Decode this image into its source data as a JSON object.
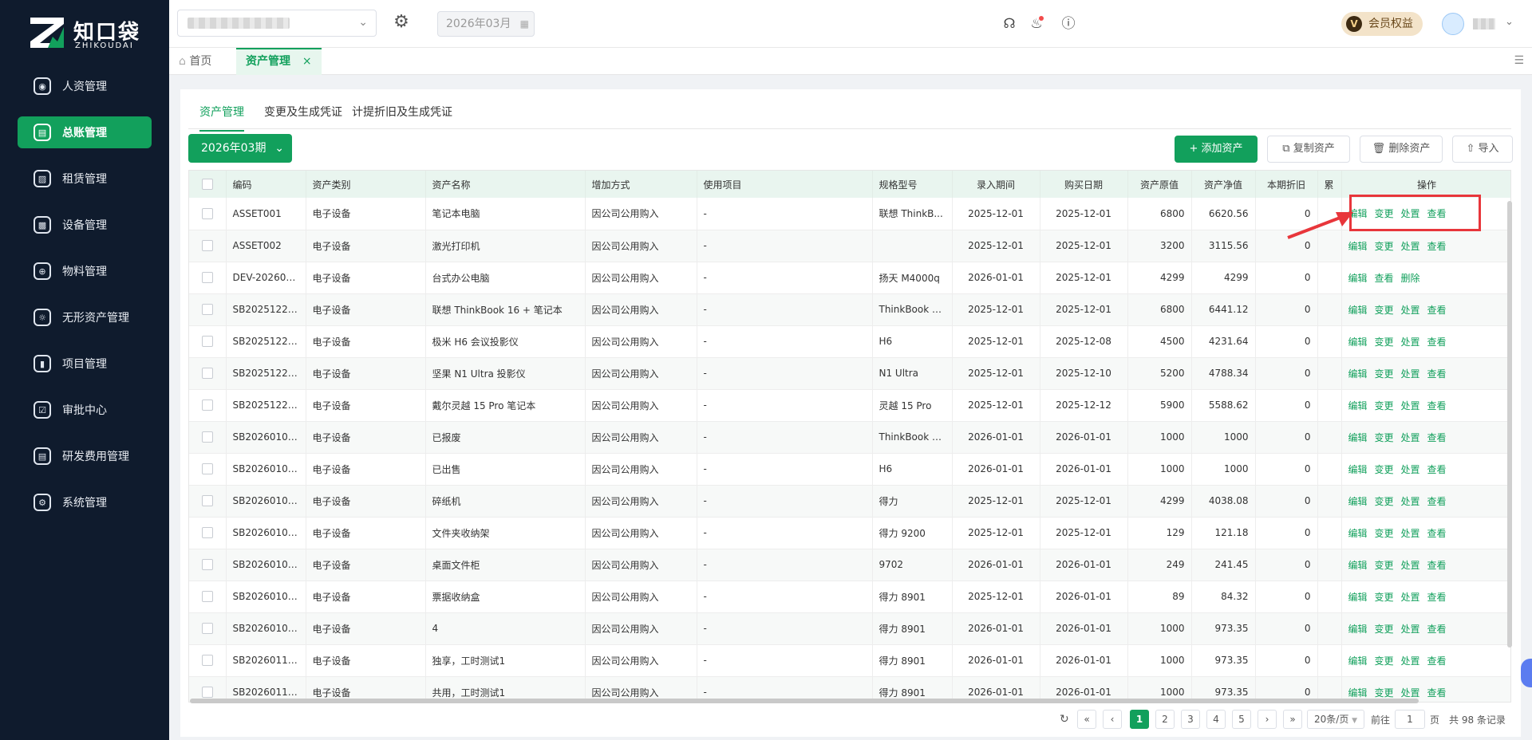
{
  "brand": {
    "name_cn": "知口袋",
    "name_en": "ZHIKOUDAI"
  },
  "sidebar": {
    "items": [
      {
        "label": "人资管理",
        "icon": "person-icon",
        "active": false
      },
      {
        "label": "总账管理",
        "icon": "ledger-icon",
        "active": true
      },
      {
        "label": "租赁管理",
        "icon": "lease-icon",
        "active": false
      },
      {
        "label": "设备管理",
        "icon": "device-icon",
        "active": false
      },
      {
        "label": "物料管理",
        "icon": "material-icon",
        "active": false
      },
      {
        "label": "无形资产管理",
        "icon": "intangible-icon",
        "active": false
      },
      {
        "label": "项目管理",
        "icon": "project-icon",
        "active": false
      },
      {
        "label": "审批中心",
        "icon": "approval-icon",
        "active": false
      },
      {
        "label": "研发费用管理",
        "icon": "rd-icon",
        "active": false
      },
      {
        "label": "系统管理",
        "icon": "gear-icon",
        "active": false
      }
    ]
  },
  "header": {
    "month": "2026年03月",
    "vip_label": "会员权益",
    "vip_badge": "V"
  },
  "tabs": {
    "home": "首页",
    "active": "资产管理"
  },
  "subtabs": [
    "资产管理",
    "变更及生成凭证",
    "计提折旧及生成凭证"
  ],
  "toolbar": {
    "period": "2026年03期",
    "add": "添加资产",
    "copy": "复制资产",
    "delete": "删除资产",
    "import": "导入"
  },
  "table": {
    "columns": [
      "编码",
      "资产类别",
      "资产名称",
      "增加方式",
      "使用项目",
      "规格型号",
      "录入期间",
      "购买日期",
      "资产原值",
      "资产净值",
      "本期折旧",
      "累",
      "操作"
    ],
    "rows": [
      {
        "code": "ASSET001",
        "cat": "电子设备",
        "name": "笔记本电脑",
        "add": "因公司公用购入",
        "proj": "-",
        "model": "联想 ThinkB...",
        "entry": "2025-12-01",
        "buy": "2025-12-01",
        "orig": "6800",
        "net": "6620.56",
        "dep": "0",
        "ops": [
          "编辑",
          "变更",
          "处置",
          "查看"
        ]
      },
      {
        "code": "ASSET002",
        "cat": "电子设备",
        "name": "激光打印机",
        "add": "因公司公用购入",
        "proj": "-",
        "model": "",
        "entry": "2025-12-01",
        "buy": "2025-12-01",
        "orig": "3200",
        "net": "3115.56",
        "dep": "0",
        "ops": [
          "编辑",
          "变更",
          "处置",
          "查看"
        ]
      },
      {
        "code": "DEV-202601...",
        "cat": "电子设备",
        "name": "台式办公电脑",
        "add": "因公司公用购入",
        "proj": "-",
        "model": "扬天 M4000q",
        "entry": "2026-01-01",
        "buy": "2025-12-01",
        "orig": "4299",
        "net": "4299",
        "dep": "0",
        "ops": [
          "编辑",
          "查看",
          "删除"
        ]
      },
      {
        "code": "SB20251225...",
        "cat": "电子设备",
        "name": "联想 ThinkBook 16 + 笔记本",
        "add": "因公司公用购入",
        "proj": "-",
        "model": "ThinkBook 1...",
        "entry": "2025-12-01",
        "buy": "2025-12-01",
        "orig": "6800",
        "net": "6441.12",
        "dep": "0",
        "ops": [
          "编辑",
          "变更",
          "处置",
          "查看"
        ]
      },
      {
        "code": "SB20251225...",
        "cat": "电子设备",
        "name": "极米 H6 会议投影仪",
        "add": "因公司公用购入",
        "proj": "-",
        "model": "H6",
        "entry": "2025-12-01",
        "buy": "2025-12-08",
        "orig": "4500",
        "net": "4231.64",
        "dep": "0",
        "ops": [
          "编辑",
          "变更",
          "处置",
          "查看"
        ]
      },
      {
        "code": "SB20251225...",
        "cat": "电子设备",
        "name": "坚果 N1 Ultra 投影仪",
        "add": "因公司公用购入",
        "proj": "-",
        "model": "N1 Ultra",
        "entry": "2025-12-01",
        "buy": "2025-12-10",
        "orig": "5200",
        "net": "4788.34",
        "dep": "0",
        "ops": [
          "编辑",
          "变更",
          "处置",
          "查看"
        ]
      },
      {
        "code": "SB20251225...",
        "cat": "电子设备",
        "name": "戴尔灵越 15 Pro 笔记本",
        "add": "因公司公用购入",
        "proj": "-",
        "model": "灵越 15 Pro",
        "entry": "2025-12-01",
        "buy": "2025-12-12",
        "orig": "5900",
        "net": "5588.62",
        "dep": "0",
        "ops": [
          "编辑",
          "变更",
          "处置",
          "查看"
        ]
      },
      {
        "code": "SB20260104...",
        "cat": "电子设备",
        "name": "已报废",
        "add": "因公司公用购入",
        "proj": "-",
        "model": "ThinkBook 1...",
        "entry": "2026-01-01",
        "buy": "2026-01-01",
        "orig": "1000",
        "net": "1000",
        "dep": "0",
        "ops": [
          "编辑",
          "变更",
          "处置",
          "查看"
        ]
      },
      {
        "code": "SB20260104...",
        "cat": "电子设备",
        "name": "已出售",
        "add": "因公司公用购入",
        "proj": "-",
        "model": "H6",
        "entry": "2026-01-01",
        "buy": "2026-01-01",
        "orig": "1000",
        "net": "1000",
        "dep": "0",
        "ops": [
          "编辑",
          "变更",
          "处置",
          "查看"
        ]
      },
      {
        "code": "SB20260104...",
        "cat": "电子设备",
        "name": "碎纸机",
        "add": "因公司公用购入",
        "proj": "-",
        "model": "得力",
        "entry": "2025-12-01",
        "buy": "2025-12-01",
        "orig": "4299",
        "net": "4038.08",
        "dep": "0",
        "ops": [
          "编辑",
          "变更",
          "处置",
          "查看"
        ]
      },
      {
        "code": "SB20260104...",
        "cat": "电子设备",
        "name": "文件夹收纳架",
        "add": "因公司公用购入",
        "proj": "-",
        "model": "得力 9200",
        "entry": "2025-12-01",
        "buy": "2025-12-01",
        "orig": "129",
        "net": "121.18",
        "dep": "0",
        "ops": [
          "编辑",
          "变更",
          "处置",
          "查看"
        ]
      },
      {
        "code": "SB20260104...",
        "cat": "电子设备",
        "name": "桌面文件柜",
        "add": "因公司公用购入",
        "proj": "-",
        "model": "9702",
        "entry": "2026-01-01",
        "buy": "2026-01-01",
        "orig": "249",
        "net": "241.45",
        "dep": "0",
        "ops": [
          "编辑",
          "变更",
          "处置",
          "查看"
        ]
      },
      {
        "code": "SB20260104...",
        "cat": "电子设备",
        "name": "票据收纳盒",
        "add": "因公司公用购入",
        "proj": "-",
        "model": "得力 8901",
        "entry": "2025-12-01",
        "buy": "2026-01-01",
        "orig": "89",
        "net": "84.32",
        "dep": "0",
        "ops": [
          "编辑",
          "变更",
          "处置",
          "查看"
        ]
      },
      {
        "code": "SB20260109...",
        "cat": "电子设备",
        "name": "4",
        "add": "因公司公用购入",
        "proj": "-",
        "model": "得力 8901",
        "entry": "2026-01-01",
        "buy": "2026-01-01",
        "orig": "1000",
        "net": "973.35",
        "dep": "0",
        "ops": [
          "编辑",
          "变更",
          "处置",
          "查看"
        ]
      },
      {
        "code": "SB20260116...",
        "cat": "电子设备",
        "name": "独享，工时测试1",
        "add": "因公司公用购入",
        "proj": "-",
        "model": "得力 8901",
        "entry": "2026-01-01",
        "buy": "2026-01-01",
        "orig": "1000",
        "net": "973.35",
        "dep": "0",
        "ops": [
          "编辑",
          "变更",
          "处置",
          "查看"
        ]
      },
      {
        "code": "SB20260116...",
        "cat": "电子设备",
        "name": "共用，工时测试1",
        "add": "因公司公用购入",
        "proj": "-",
        "model": "得力 8901",
        "entry": "2026-01-01",
        "buy": "2026-01-01",
        "orig": "1000",
        "net": "973.35",
        "dep": "0",
        "ops": [
          "编辑",
          "变更",
          "处置",
          "查看"
        ]
      }
    ]
  },
  "pagination": {
    "pages": [
      "1",
      "2",
      "3",
      "4",
      "5"
    ],
    "current": "1",
    "page_size": "20条/页",
    "goto_label": "前往",
    "goto_value": "1",
    "page_unit": "页",
    "total": "共 98 条记录"
  },
  "colors": {
    "primary": "#12a05c",
    "sidebar": "#0f1b2d",
    "highlight": "#e8363b"
  }
}
